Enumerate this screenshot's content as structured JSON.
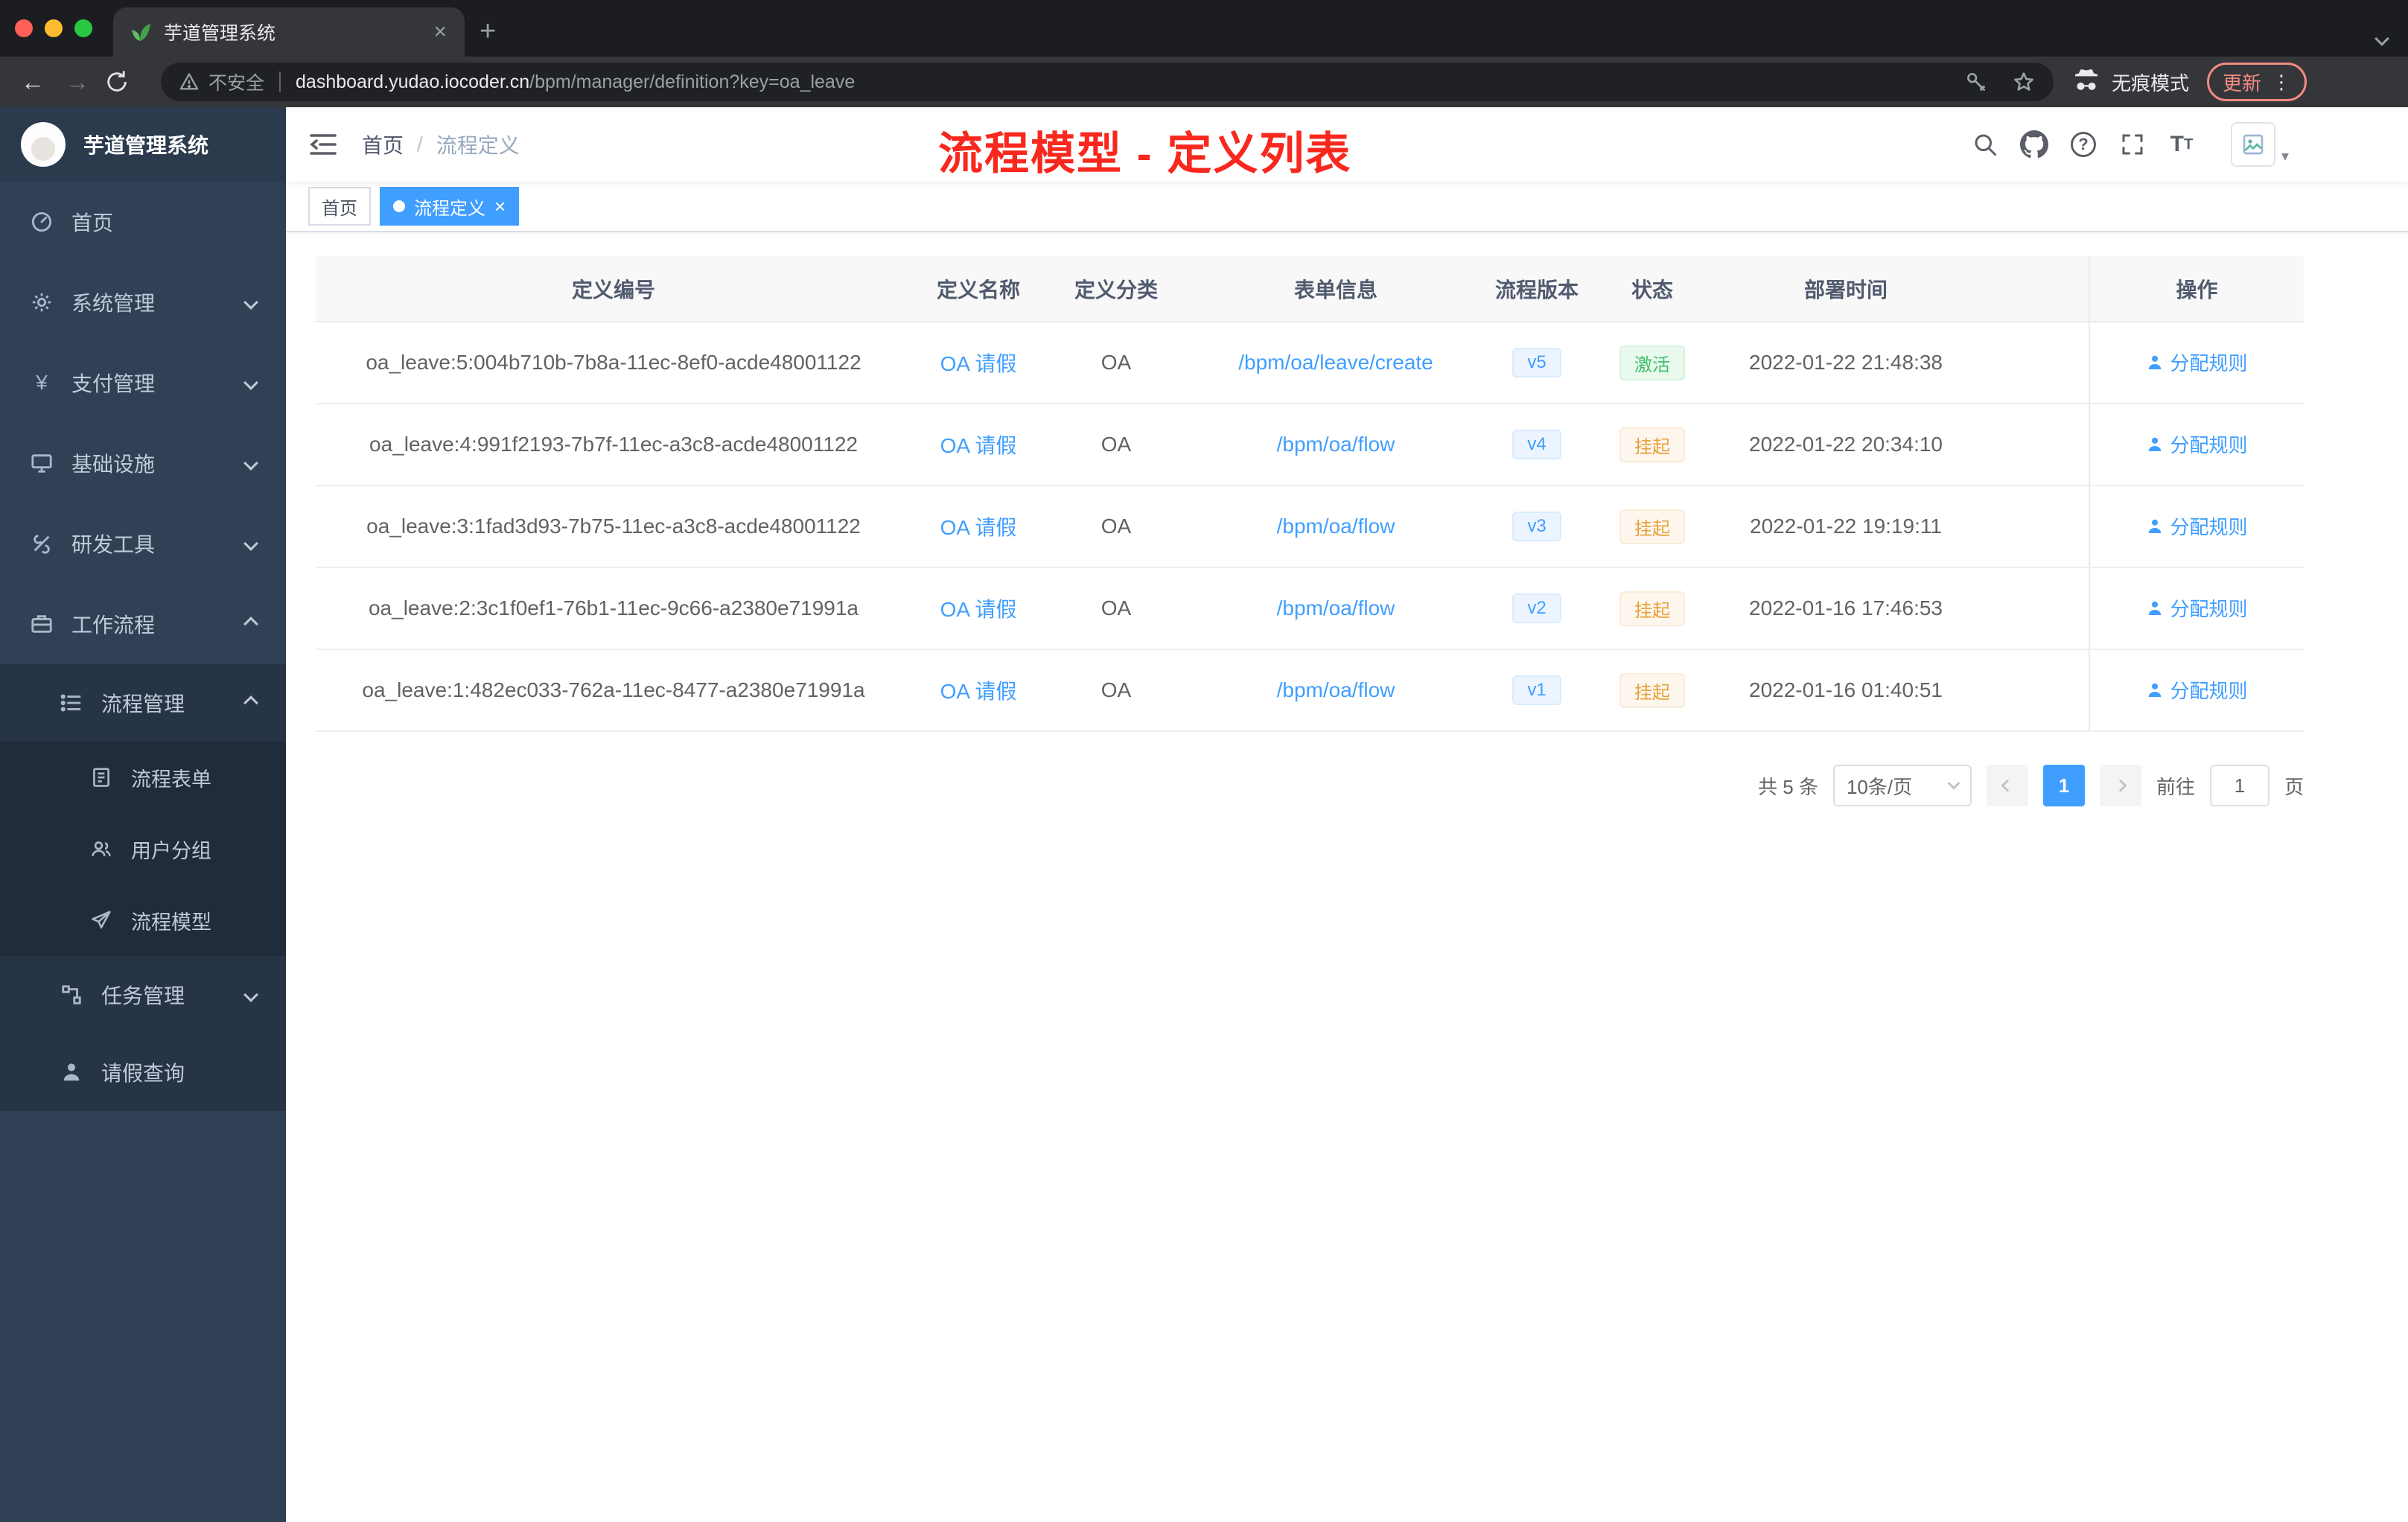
{
  "colors": {
    "accent": "#409eff",
    "annotation_red": "#f8281e",
    "success": "#3fbf6b",
    "warning": "#e6a23c"
  },
  "browser": {
    "tab_title": "芋道管理系统",
    "security_label": "不安全",
    "url_host": "dashboard.yudao.iocoder.cn",
    "url_path": "/bpm/manager/definition?key=oa_leave",
    "incognito_label": "无痕模式",
    "update_label": "更新",
    "menu_dots": "⋮",
    "back": "←",
    "forward": "→",
    "new_tab": "+",
    "close_tab": "×"
  },
  "sidebar": {
    "logo_title": "芋道管理系统",
    "items": [
      {
        "label": "首页"
      },
      {
        "label": "系统管理"
      },
      {
        "label": "支付管理"
      },
      {
        "label": "基础设施"
      },
      {
        "label": "研发工具"
      },
      {
        "label": "工作流程"
      },
      {
        "label": "流程管理"
      },
      {
        "label": "流程表单"
      },
      {
        "label": "用户分组"
      },
      {
        "label": "流程模型"
      },
      {
        "label": "任务管理"
      },
      {
        "label": "请假查询"
      }
    ]
  },
  "header": {
    "breadcrumb_home": "首页",
    "breadcrumb_sep": "/",
    "breadcrumb_current": "流程定义",
    "annotation": "流程模型 - 定义列表"
  },
  "tags": [
    {
      "label": "首页"
    },
    {
      "label": "流程定义",
      "close": "×"
    }
  ],
  "table": {
    "columns": [
      "定义编号",
      "定义名称",
      "定义分类",
      "表单信息",
      "流程版本",
      "状态",
      "部署时间",
      "操作"
    ],
    "rows": [
      {
        "id": "oa_leave:5:004b710b-7b8a-11ec-8ef0-acde48001122",
        "name": "OA 请假",
        "category": "OA",
        "form": "/bpm/oa/leave/create",
        "version": "v5",
        "status": "激活",
        "time": "2022-01-22 21:48:38",
        "action": "分配规则"
      },
      {
        "id": "oa_leave:4:991f2193-7b7f-11ec-a3c8-acde48001122",
        "name": "OA 请假",
        "category": "OA",
        "form": "/bpm/oa/flow",
        "version": "v4",
        "status": "挂起",
        "time": "2022-01-22 20:34:10",
        "action": "分配规则"
      },
      {
        "id": "oa_leave:3:1fad3d93-7b75-11ec-a3c8-acde48001122",
        "name": "OA 请假",
        "category": "OA",
        "form": "/bpm/oa/flow",
        "version": "v3",
        "status": "挂起",
        "time": "2022-01-22 19:19:11",
        "action": "分配规则"
      },
      {
        "id": "oa_leave:2:3c1f0ef1-76b1-11ec-9c66-a2380e71991a",
        "name": "OA 请假",
        "category": "OA",
        "form": "/bpm/oa/flow",
        "version": "v2",
        "status": "挂起",
        "time": "2022-01-16 17:46:53",
        "action": "分配规则"
      },
      {
        "id": "oa_leave:1:482ec033-762a-11ec-8477-a2380e71991a",
        "name": "OA 请假",
        "category": "OA",
        "form": "/bpm/oa/flow",
        "version": "v1",
        "status": "挂起",
        "time": "2022-01-16 01:40:51",
        "action": "分配规则"
      }
    ]
  },
  "pagination": {
    "total": "共 5 条",
    "page_size": "10条/页",
    "current": "1",
    "goto_label": "前往",
    "goto_value": "1",
    "page_unit": "页"
  }
}
